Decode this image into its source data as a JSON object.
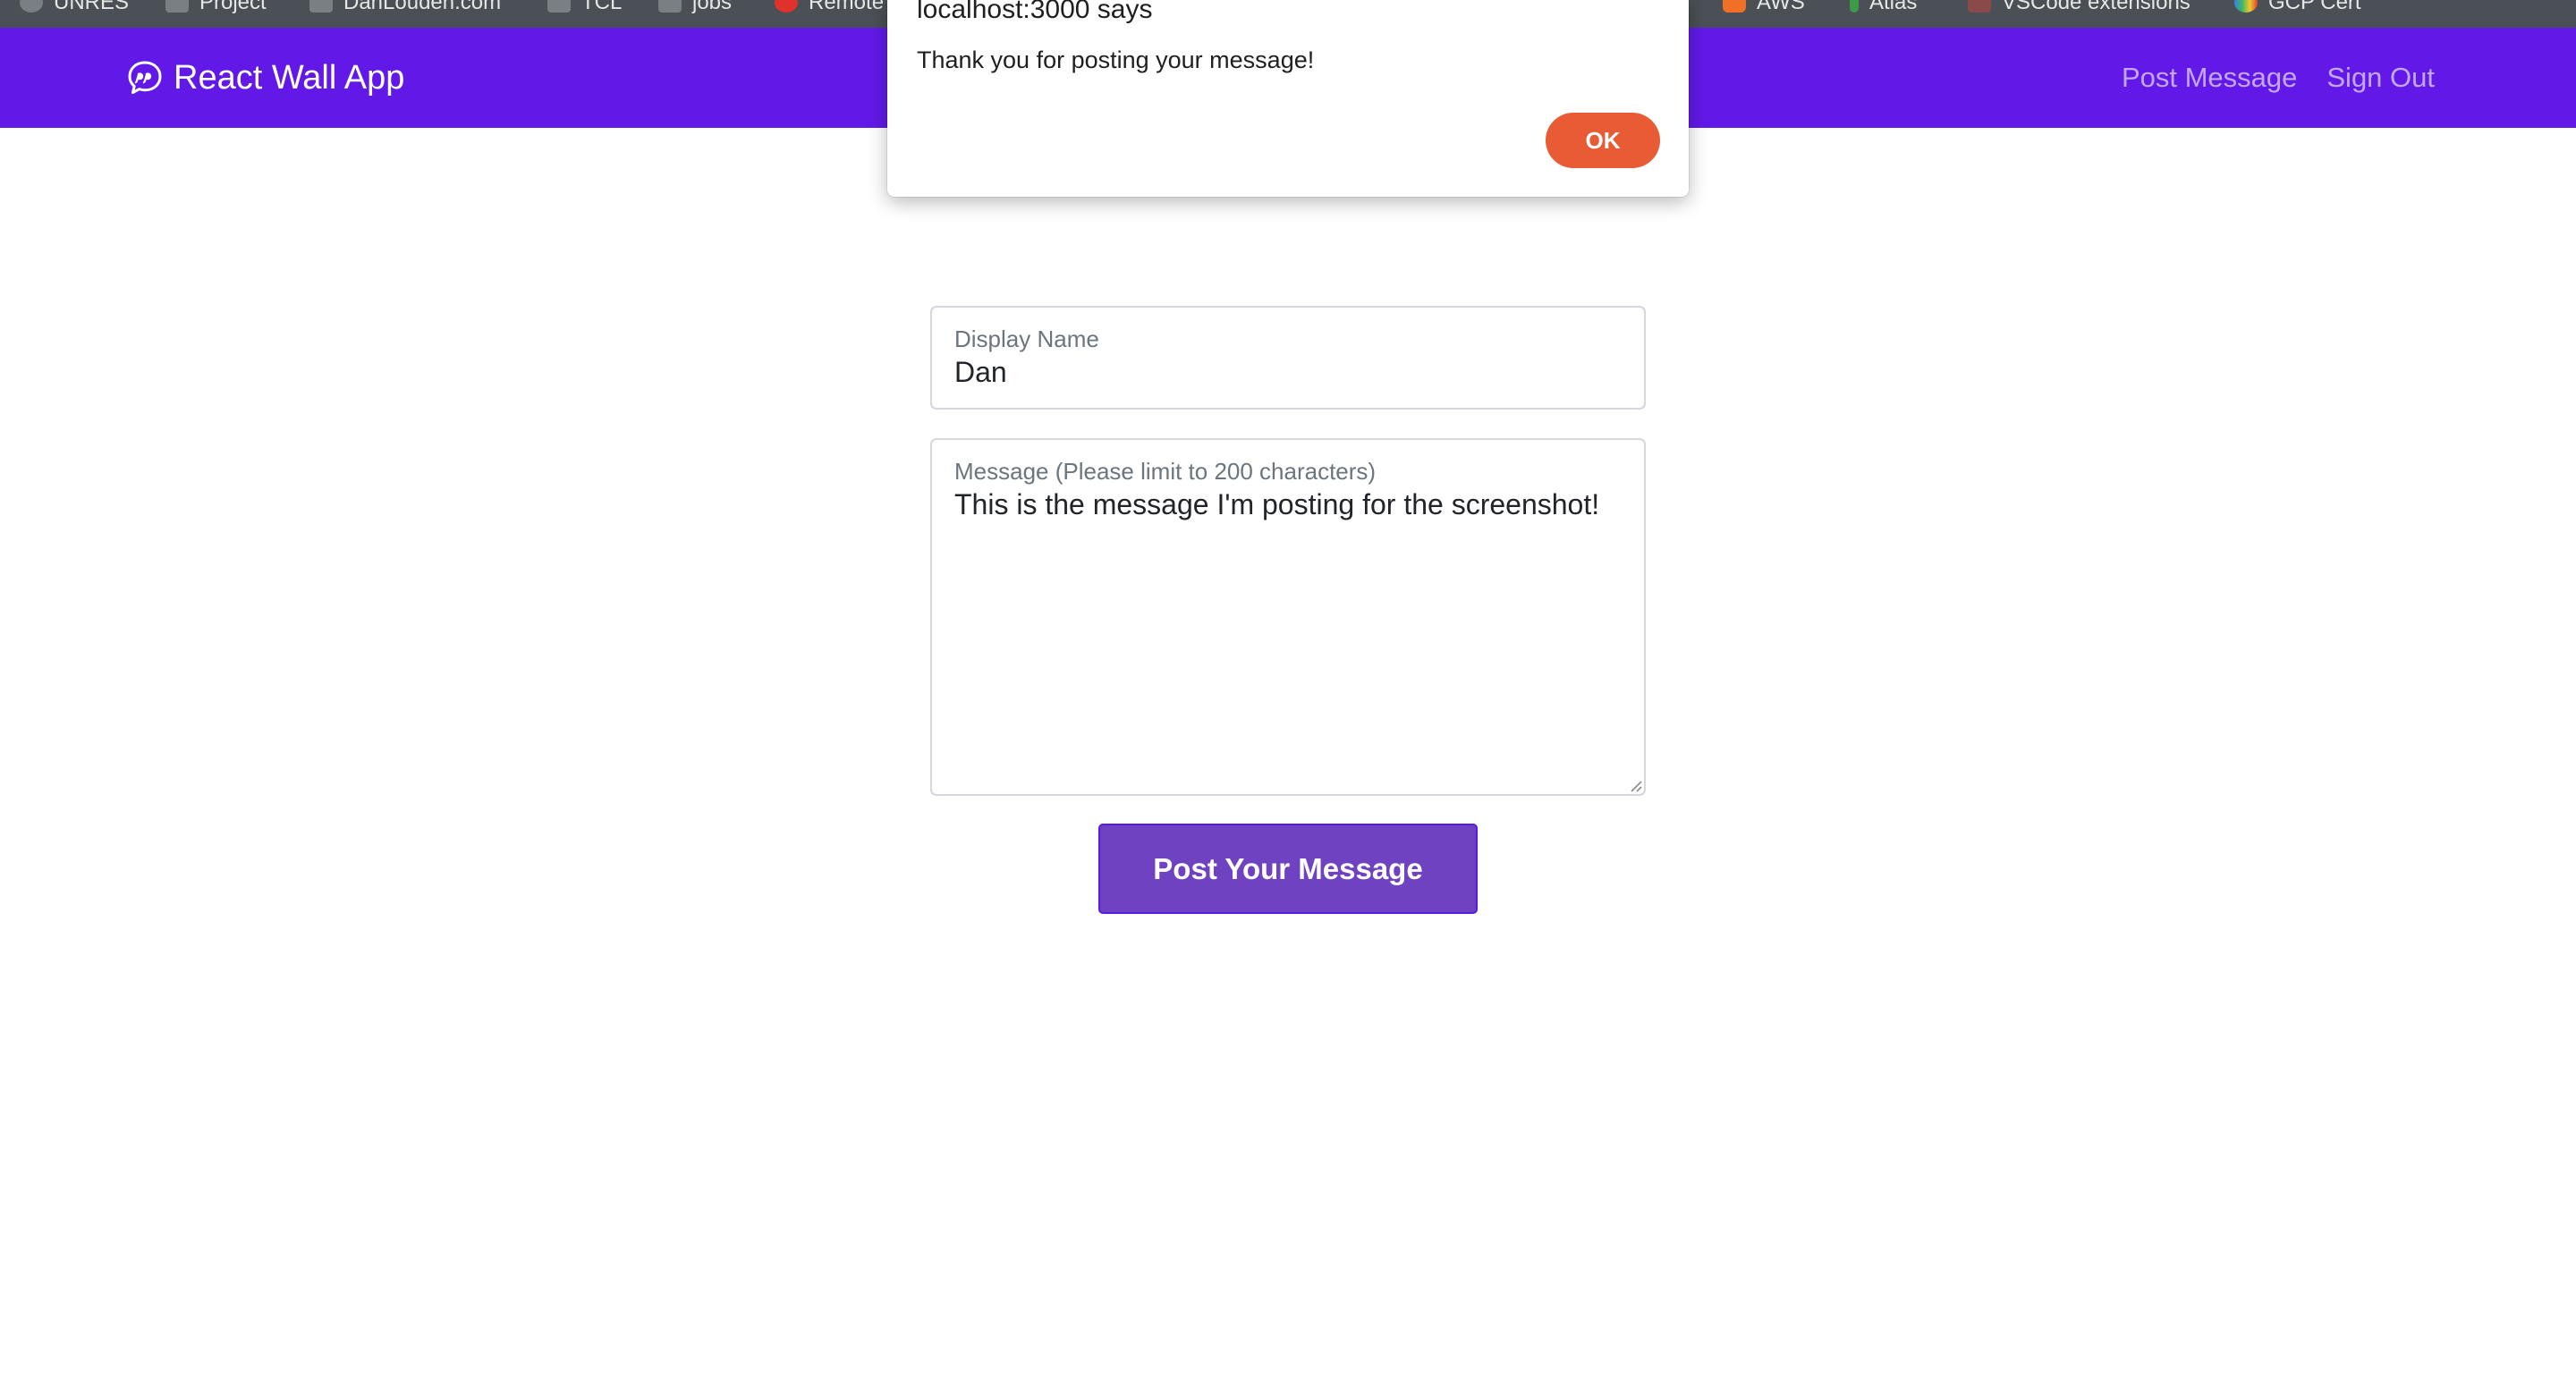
{
  "browser": {
    "bookmarks": [
      {
        "label": "UNRES",
        "icon": "github-icon"
      },
      {
        "label": "Project",
        "icon": "folder-icon"
      },
      {
        "label": "DanLouden.com",
        "icon": "folder-icon"
      },
      {
        "label": "TCL",
        "icon": "folder-icon"
      },
      {
        "label": "jobs",
        "icon": "folder-icon"
      },
      {
        "label": "Remote",
        "icon": "red-circle-icon"
      },
      {
        "label": "AWS",
        "icon": "aws-icon"
      },
      {
        "label": "Atlas",
        "icon": "leaf-icon"
      },
      {
        "label": "VSCode extensions",
        "icon": "vscode-icon"
      },
      {
        "label": "GCP Cert",
        "icon": "google-icon"
      }
    ]
  },
  "navbar": {
    "brand_label": "React Wall App",
    "brand_icon": "quote-bubble-icon",
    "links": [
      {
        "label": "Post Message"
      },
      {
        "label": "Sign Out"
      }
    ],
    "background_color": "#6219e8"
  },
  "form": {
    "display_name": {
      "label": "Display Name",
      "value": "Dan"
    },
    "message": {
      "label": "Message (Please limit to 200 characters)",
      "value": "This is the message I'm posting for the screenshot!"
    },
    "submit_label": "Post Your Message",
    "submit_color": "#6f42c1"
  },
  "alert": {
    "title": "localhost:3000 says",
    "message": "Thank you for posting your message!",
    "ok_label": "OK",
    "ok_color": "#e85b34"
  }
}
